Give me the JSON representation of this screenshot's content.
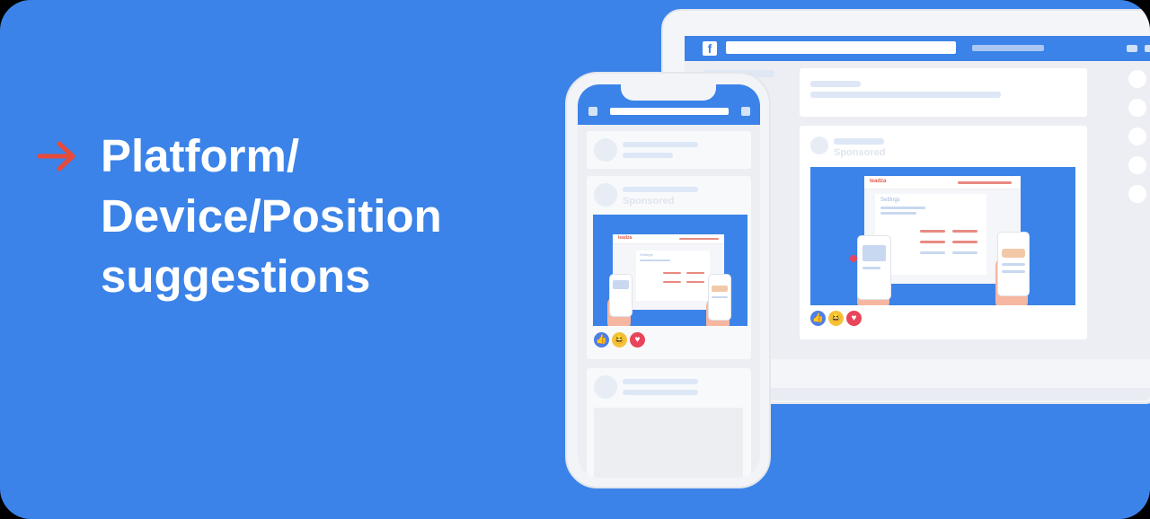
{
  "headline": {
    "line1": "Platform/",
    "line2": "Device/Position",
    "line3": "suggestions"
  },
  "desktop_mockup": {
    "logo": "f",
    "post_label": "Sponsored",
    "ad_brand": "leadza",
    "ad_page_title": "Settings"
  },
  "phone_mockup": {
    "post_label": "Sponsored",
    "ad_brand": "leadza",
    "ad_page_title": "Settings"
  },
  "reactions": [
    "like",
    "haha",
    "love"
  ],
  "colors": {
    "background": "#3b83e8",
    "arrow": "#e84a3a",
    "text": "#ffffff"
  }
}
